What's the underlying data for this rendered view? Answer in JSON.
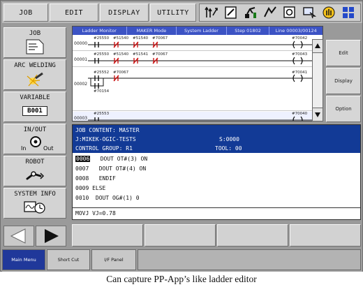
{
  "top_menu": [
    "JOB",
    "EDIT",
    "DISPLAY",
    "UTILITY"
  ],
  "side_menu": {
    "job": "JOB",
    "arc": "ARC WELDING",
    "variable": "VARIABLE",
    "variable_value": "B001",
    "inout": "IN/OUT",
    "in_label": "In",
    "out_label": "Out",
    "robot": "ROBOT",
    "sysinfo": "SYSTEM INFO"
  },
  "ladder": {
    "header": [
      "Ladder Monitor",
      "MAKER Mode",
      "System Ladder",
      "Step 01802",
      "Line 00003/00124"
    ],
    "rungs": [
      {
        "num": "00000",
        "vars": [
          "#25550",
          "#51540",
          "#51540",
          "#70067"
        ],
        "coil": "#70042"
      },
      {
        "num": "00001",
        "vars": [
          "#25550",
          "#51540",
          "#51541",
          "#70067"
        ],
        "coil": "#70043"
      },
      {
        "num": "00002",
        "vars": [
          "#25552",
          "#70067"
        ],
        "branch": "#70154",
        "coil": "#70041"
      },
      {
        "num": "00003",
        "vars": [
          "#25553"
        ],
        "coil": "#70040"
      }
    ],
    "side_buttons": [
      "Edit",
      "Display",
      "Option"
    ]
  },
  "job": {
    "content_label": "JOB CONTENT: MASTER",
    "job_name": "J:MIKEK-OGIC-TESTS",
    "step": "S:0000",
    "control_group": "CONTROL GROUP: R1",
    "tool": "TOOL: 00",
    "lines": [
      {
        "no": "0006",
        "text": "DOUT OT#(3) ON",
        "selected": true
      },
      {
        "no": "0007",
        "text": "DOUT OT#(4) ON",
        "selected": false
      },
      {
        "no": "0008",
        "text": "ENDIF",
        "selected": false
      },
      {
        "no": "0009",
        "text": "ELSE",
        "selected": false
      },
      {
        "no": "0010",
        "text": "DOUT OG#(1) 0",
        "selected": false
      }
    ],
    "input": "MOVJ VJ=0.78"
  },
  "tasks": [
    "Main Menu",
    "Short Cut",
    "I/F Panel"
  ],
  "caption": "Can capture PP-App’s like ladder editor",
  "colors": {
    "ladder_header": "#3c53c4",
    "job_header": "#123a96",
    "contact_red": "#cc1a1a"
  }
}
